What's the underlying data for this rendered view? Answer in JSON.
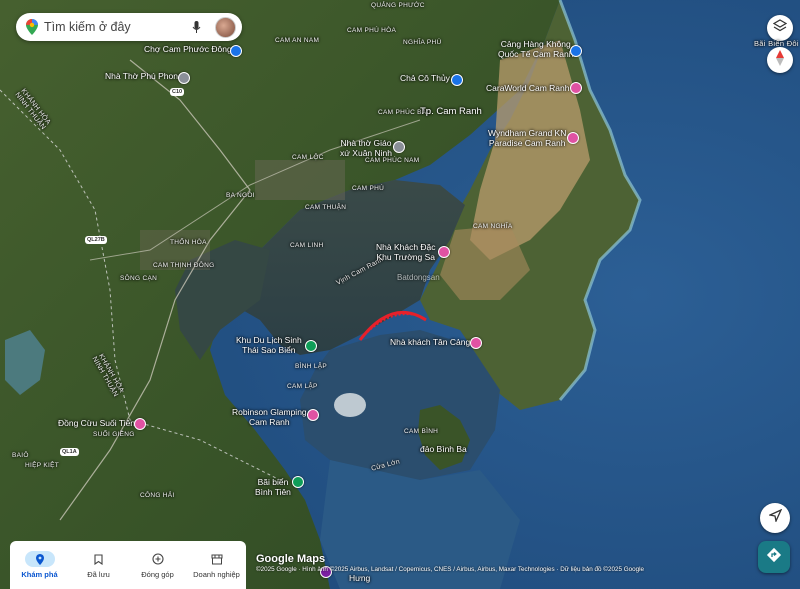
{
  "search": {
    "placeholder": "Tìm kiếm ở đây"
  },
  "places": {
    "quang_phuoc": "QUẢNG PHƯỚC",
    "cam_an_nam": "CAM AN NAM",
    "cam_phuoc_dong_area": "CAM PHƯỚC ĐÔNG",
    "cam_phu_hoa": "CAM PHÚ HÒA",
    "nghia_phu": "NGHĨA PHÚ",
    "cam_phuc_bac": "CAM PHÚC BẮC",
    "cam_loc": "CAM LỘC",
    "cam_phuc_nam": "CAM PHÚC NAM",
    "ba_ngoi": "BA NGÒI",
    "cam_thuan": "CAM THUẬN",
    "cam_phu": "CAM PHÚ",
    "cam_linh": "CAM LINH",
    "thon_hoa": "THỐN HÒA",
    "cam_thinh_dong": "CAM THỊNH ĐÔNG",
    "song_can": "SÔNG CẠN",
    "cam_nghia": "CAM NGHĨA",
    "cam_lap": "CAM LẬP",
    "binh_lap": "BÌNH LẬP",
    "cam_binh": "CAM BÌNH",
    "suoi_gieng": "SUỐI GIỀNG",
    "baio": "BAIÔ",
    "hiep_kiet": "HIỆP KIỆT",
    "cong_hai": "CÔNG HẢI",
    "khanh_hoa_ninh_thuan_1": "KHÁNH HÒA\nNINH THUẬN",
    "khanh_hoa_ninh_thuan_2": "KHÁNH HÒA\nNINH THUẬN",
    "vinh_cam_ranh": "Vịnh Cam Ranh",
    "cua_lon": "Cửa Lớn",
    "tp_cam_ranh": "Tp. Cam Ranh",
    "bai_bien_doi": "Bãi Biển Đôi"
  },
  "roads": {
    "c10": "C10",
    "ql27b": "QL27B",
    "ql1a": "QL1A"
  },
  "pois": {
    "cho_cam_phuoc_dong": "Chợ Cam Phước Đông",
    "nha_tho_phu_phong": "Nhà Thờ Phú Phong",
    "cha_co_thuy": "Chả Cô Thủy",
    "nha_tho_giao_xu": "Nhà thờ Giáo\nxứ Xuân Ninh",
    "cang_hang_khong": "Cảng Hàng Không\nQuốc Tế Cam Ranh",
    "caraworld": "CaraWorld Cam Ranh",
    "wyndham": "Wyndham Grand KN\nParadise Cam Ranh",
    "nha_khach_dac_khu": "Nhà Khách Đặc\nKhu Trường Sa",
    "khu_du_lich": "Khu Du Lịch Sinh\nThái Sao Biển",
    "nha_khach_tan_cang": "Nhà khách Tân Cảng",
    "robinson": "Robinson Glamping\nCam Ranh",
    "dong_cuu_suoi_tien": "Đồng Cừu Suối Tiên",
    "dao_binh_ba": "đảo Bình Ba",
    "bai_bien_binh_tien": "Bãi biển\nBình Tiên",
    "hung": "Hưng"
  },
  "watermark": "Batdongsan",
  "attribution": {
    "logo": "Google Maps",
    "text": "©2025 Google · Hình ảnh ©2025 Airbus, Landsat / Copernicus, CNES / Airbus, Airbus, Maxar Technologies · Dữ liệu bản đồ ©2025 Google"
  },
  "nav": {
    "explore": "Khám phá",
    "saved": "Đã lưu",
    "contribute": "Đóng góp",
    "business": "Doanh nghiệp"
  },
  "colors": {
    "sea": "#2a5c8f",
    "land": "#3f5a2c",
    "bridge": "#e8202a",
    "nav_active": "#c8e6fb",
    "dir_button": "#1a7a86"
  }
}
